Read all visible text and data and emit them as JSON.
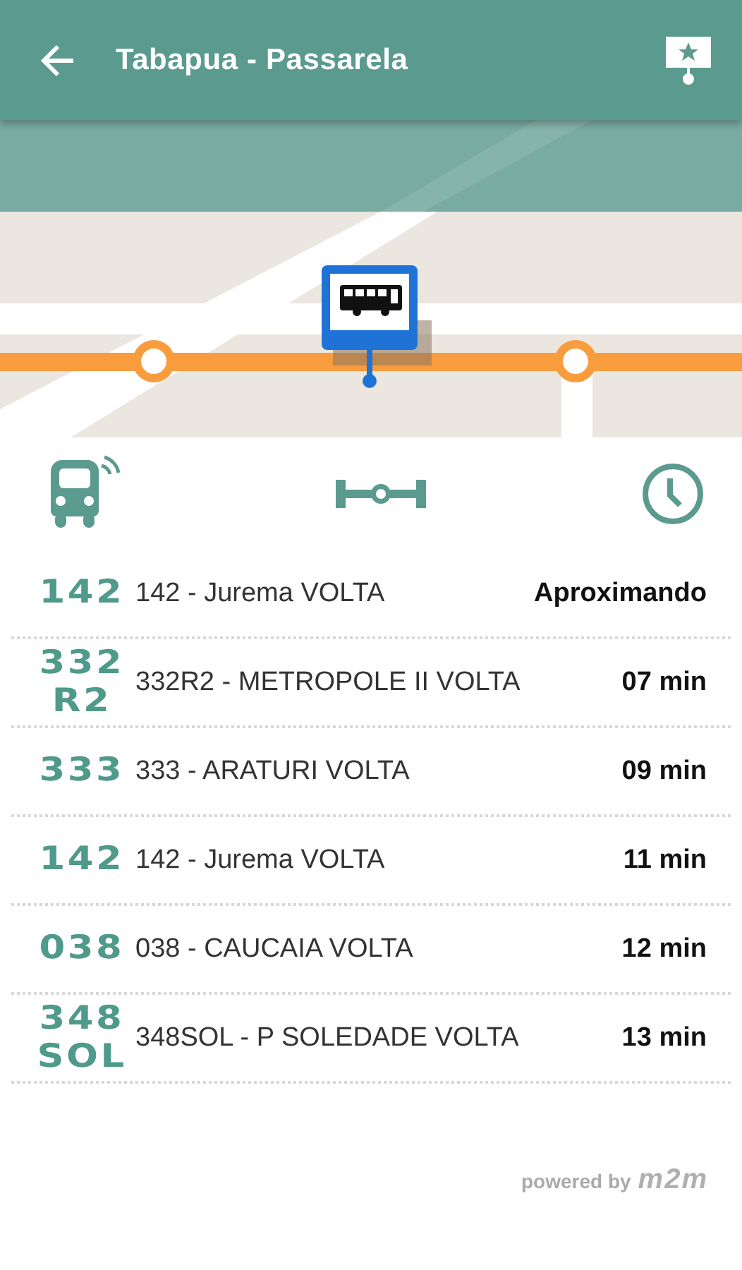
{
  "app_bar": {
    "title": "Tabapua - Passarela"
  },
  "columns": [
    {
      "kind": "bus"
    },
    {
      "kind": "route"
    },
    {
      "kind": "clock"
    }
  ],
  "arrivals": [
    {
      "code_lines": [
        "142"
      ],
      "name": "142 - Jurema VOLTA",
      "eta": "Aproximando"
    },
    {
      "code_lines": [
        "332",
        "R2"
      ],
      "name": "332R2 - METROPOLE II VOLTA",
      "eta": "07 min"
    },
    {
      "code_lines": [
        "333"
      ],
      "name": "333 - ARATURI VOLTA",
      "eta": "09 min"
    },
    {
      "code_lines": [
        "142"
      ],
      "name": "142 - Jurema VOLTA",
      "eta": "11 min"
    },
    {
      "code_lines": [
        "038"
      ],
      "name": "038 - CAUCAIA VOLTA",
      "eta": "12 min"
    },
    {
      "code_lines": [
        "348",
        "SOL"
      ],
      "name": "348SOL - P SOLEDADE VOLTA",
      "eta": "13 min"
    }
  ],
  "footer": {
    "text": "powered by",
    "logo": "m2m"
  }
}
